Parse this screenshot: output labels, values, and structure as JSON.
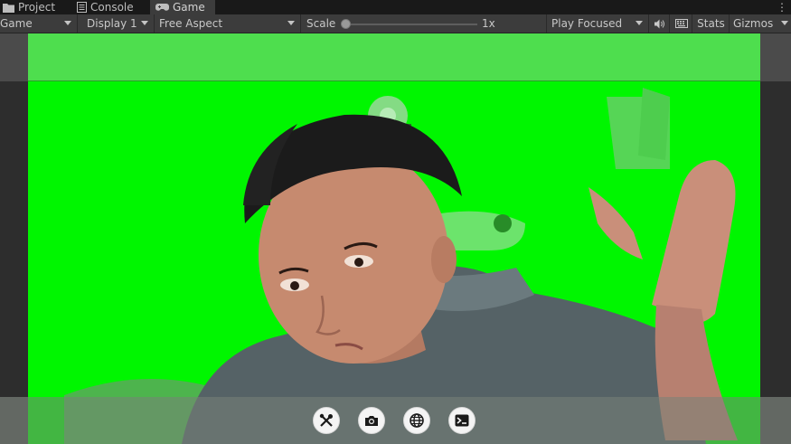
{
  "tabs": [
    {
      "label": "Project",
      "icon": "folder-icon"
    },
    {
      "label": "Console",
      "icon": "console-icon"
    },
    {
      "label": "Game",
      "icon": "gamepad-icon",
      "active": true
    }
  ],
  "toolbar": {
    "view_mode": "Game",
    "display": "Display 1",
    "aspect": "Free Aspect",
    "scale_label": "Scale",
    "scale_value": "1x",
    "scale_level": 0.0,
    "play_mode": "Play Focused",
    "stats_label": "Stats",
    "gizmos_label": "Gizmos"
  },
  "game_view": {
    "background_color": "#00f600",
    "footer_buttons": [
      {
        "icon": "tools-icon"
      },
      {
        "icon": "camera-icon"
      },
      {
        "icon": "globe-icon"
      },
      {
        "icon": "terminal-icon"
      }
    ]
  }
}
